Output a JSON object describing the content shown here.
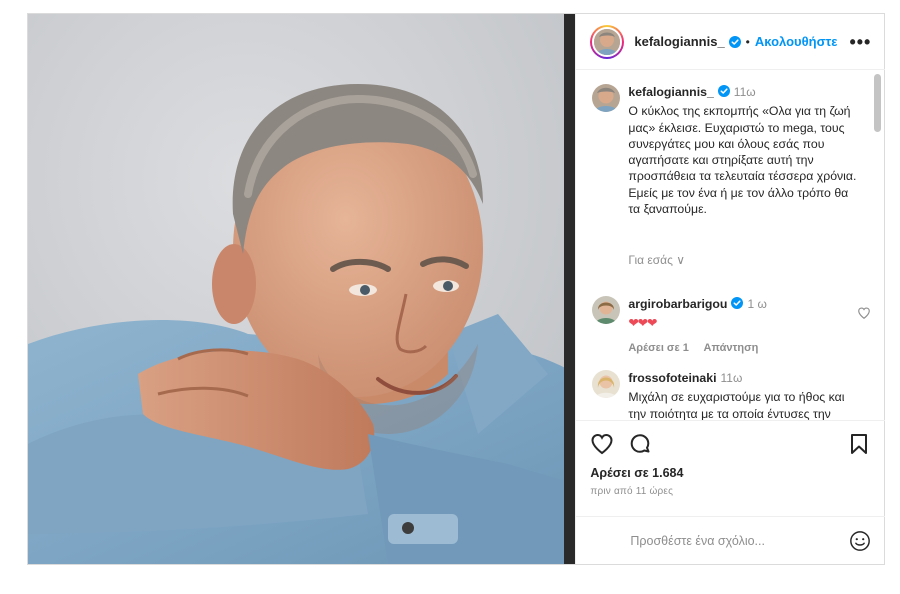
{
  "post": {
    "username": "kefalogiannis_",
    "dot": "•",
    "follow_label": "Ακολουθήστε",
    "more_label": "•••"
  },
  "caption": {
    "username": "kefalogiannis_",
    "time": "11ω",
    "text": "Ο κύκλος της εκπομπής «Ολα για τη ζωή μας» έκλεισε.  Ευχαριστώ  το mega, τους συνεργάτες μου και όλους εσάς που αγαπήσατε και στηρίξατε αυτή την προσπάθεια τα τελευταία  τέσσερα χρόνια. Εμείς με τον ένα ή με τον άλλο τρόπο θα τα ξαναπούμε.",
    "for_you": "Για εσάς ∨"
  },
  "comments": [
    {
      "username": "argirobarbarigou",
      "time": "1 ω",
      "text": "❤❤❤",
      "likes_label": "Αρέσει σε 1",
      "reply_label": "Απάντηση"
    },
    {
      "username": "frossofoteinaki",
      "time": "11ω",
      "text": "Μιχάλη σε ευχαριστούμε για το ήθος και την ποιότητα με τα οποία έντυσες την τηλεοπτική"
    }
  ],
  "actions": {
    "likes": "Αρέσει σε 1.684",
    "time_ago": "πριν από 11 ώρες"
  },
  "add_comment": {
    "placeholder": "Προσθέστε ένα σχόλιο..."
  },
  "icons": {
    "header_avatar": "profile-avatar",
    "verified": "verified-badge-icon",
    "heart": "heart-icon",
    "comment": "comment-icon",
    "bookmark": "bookmark-icon",
    "emoji": "smiley-icon"
  },
  "colors": {
    "link_blue": "#0095f6",
    "text": "#262626",
    "secondary": "#8e8e8e",
    "heart_red": "#ed4956"
  }
}
